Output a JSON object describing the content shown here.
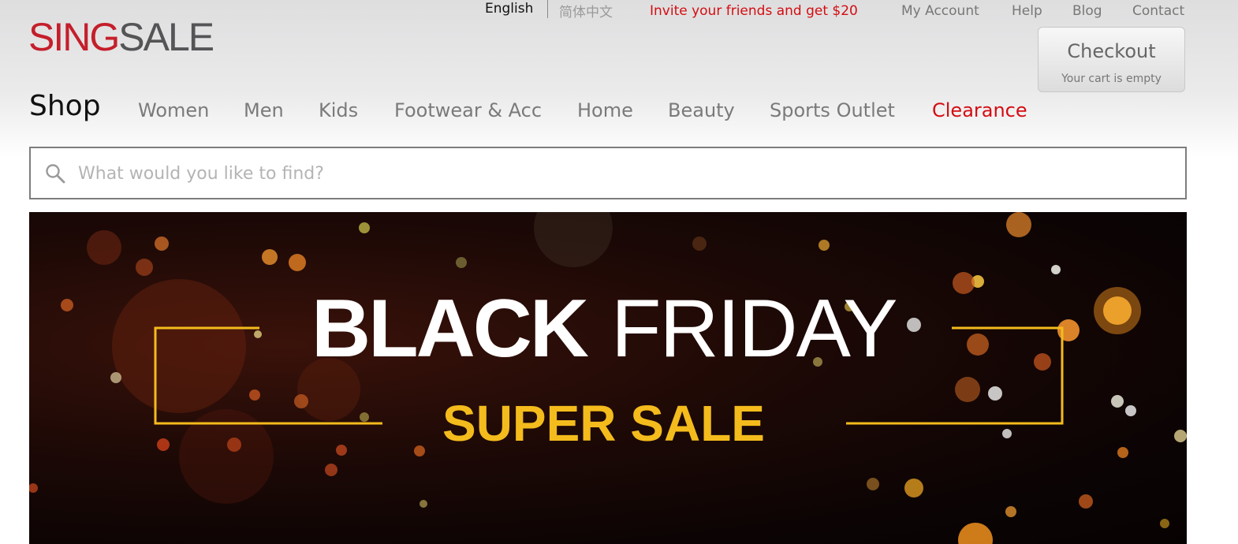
{
  "logo": {
    "part1": "SING",
    "part2": "SALE"
  },
  "language": {
    "english": "English",
    "chinese": "简体中文"
  },
  "top_links": {
    "invite": "Invite your friends and get $20",
    "my_account": "My Account",
    "help": "Help",
    "blog": "Blog",
    "contact": "Contact"
  },
  "checkout": {
    "title": "Checkout",
    "status": "Your cart is empty"
  },
  "nav": {
    "shop_label": "Shop",
    "items": [
      "Women",
      "Men",
      "Kids",
      "Footwear & Acc",
      "Home",
      "Beauty",
      "Sports Outlet",
      "Clearance"
    ]
  },
  "search": {
    "placeholder": "What would you like to find?",
    "value": ""
  },
  "banner": {
    "line1_bold": "BLACK",
    "line1_light": "FRIDAY",
    "line2": "SUPER SALE"
  },
  "colors": {
    "brand_red": "#c41f2b",
    "brand_gray": "#555557",
    "accent_red": "#d40d12",
    "banner_yellow": "#f4bb1c"
  }
}
